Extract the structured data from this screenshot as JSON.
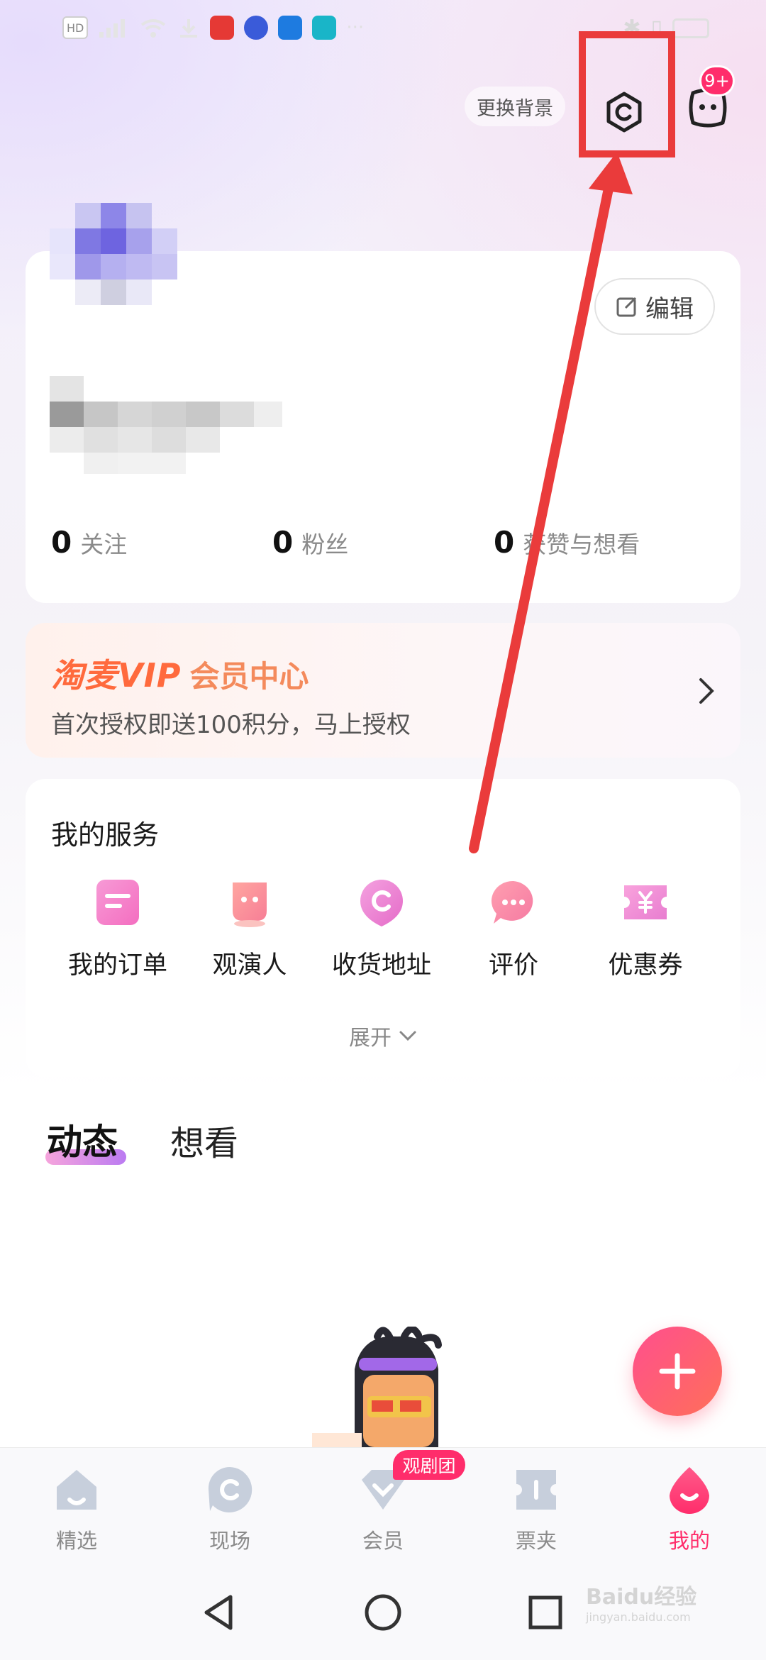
{
  "header": {
    "change_background": "更换背景",
    "message_badge": "9+"
  },
  "profile": {
    "edit_label": "编辑",
    "stats": [
      {
        "num": "0",
        "label": "关注"
      },
      {
        "num": "0",
        "label": "粉丝"
      },
      {
        "num": "0",
        "label": "获赞与想看"
      }
    ]
  },
  "vip": {
    "brand": "淘麦VIP",
    "title": "会员中心",
    "desc": "首次授权即送100积分，马上授权"
  },
  "services": {
    "title": "我的服务",
    "items": [
      {
        "label": "我的订单",
        "icon": "order-icon"
      },
      {
        "label": "观演人",
        "icon": "audience-icon"
      },
      {
        "label": "收货地址",
        "icon": "address-icon"
      },
      {
        "label": "评价",
        "icon": "review-icon"
      },
      {
        "label": "优惠券",
        "icon": "coupon-icon"
      }
    ],
    "expand_label": "展开"
  },
  "tabs": {
    "active": "动态",
    "inactive": "想看"
  },
  "bottom_nav": {
    "items": [
      {
        "label": "精选",
        "icon": "home-icon"
      },
      {
        "label": "现场",
        "icon": "live-icon"
      },
      {
        "label": "会员",
        "icon": "member-icon"
      },
      {
        "label": "票夹",
        "icon": "ticket-icon"
      },
      {
        "label": "我的",
        "icon": "profile-icon"
      }
    ],
    "badge": "观剧团",
    "active_index": 4
  },
  "colors": {
    "accent": "#ff2d6b",
    "vip_orange": "#ff6a3d",
    "annotation_red": "#ea3b3b"
  },
  "watermark": {
    "brand": "Baidu经验",
    "url": "jingyan.baidu.com"
  }
}
